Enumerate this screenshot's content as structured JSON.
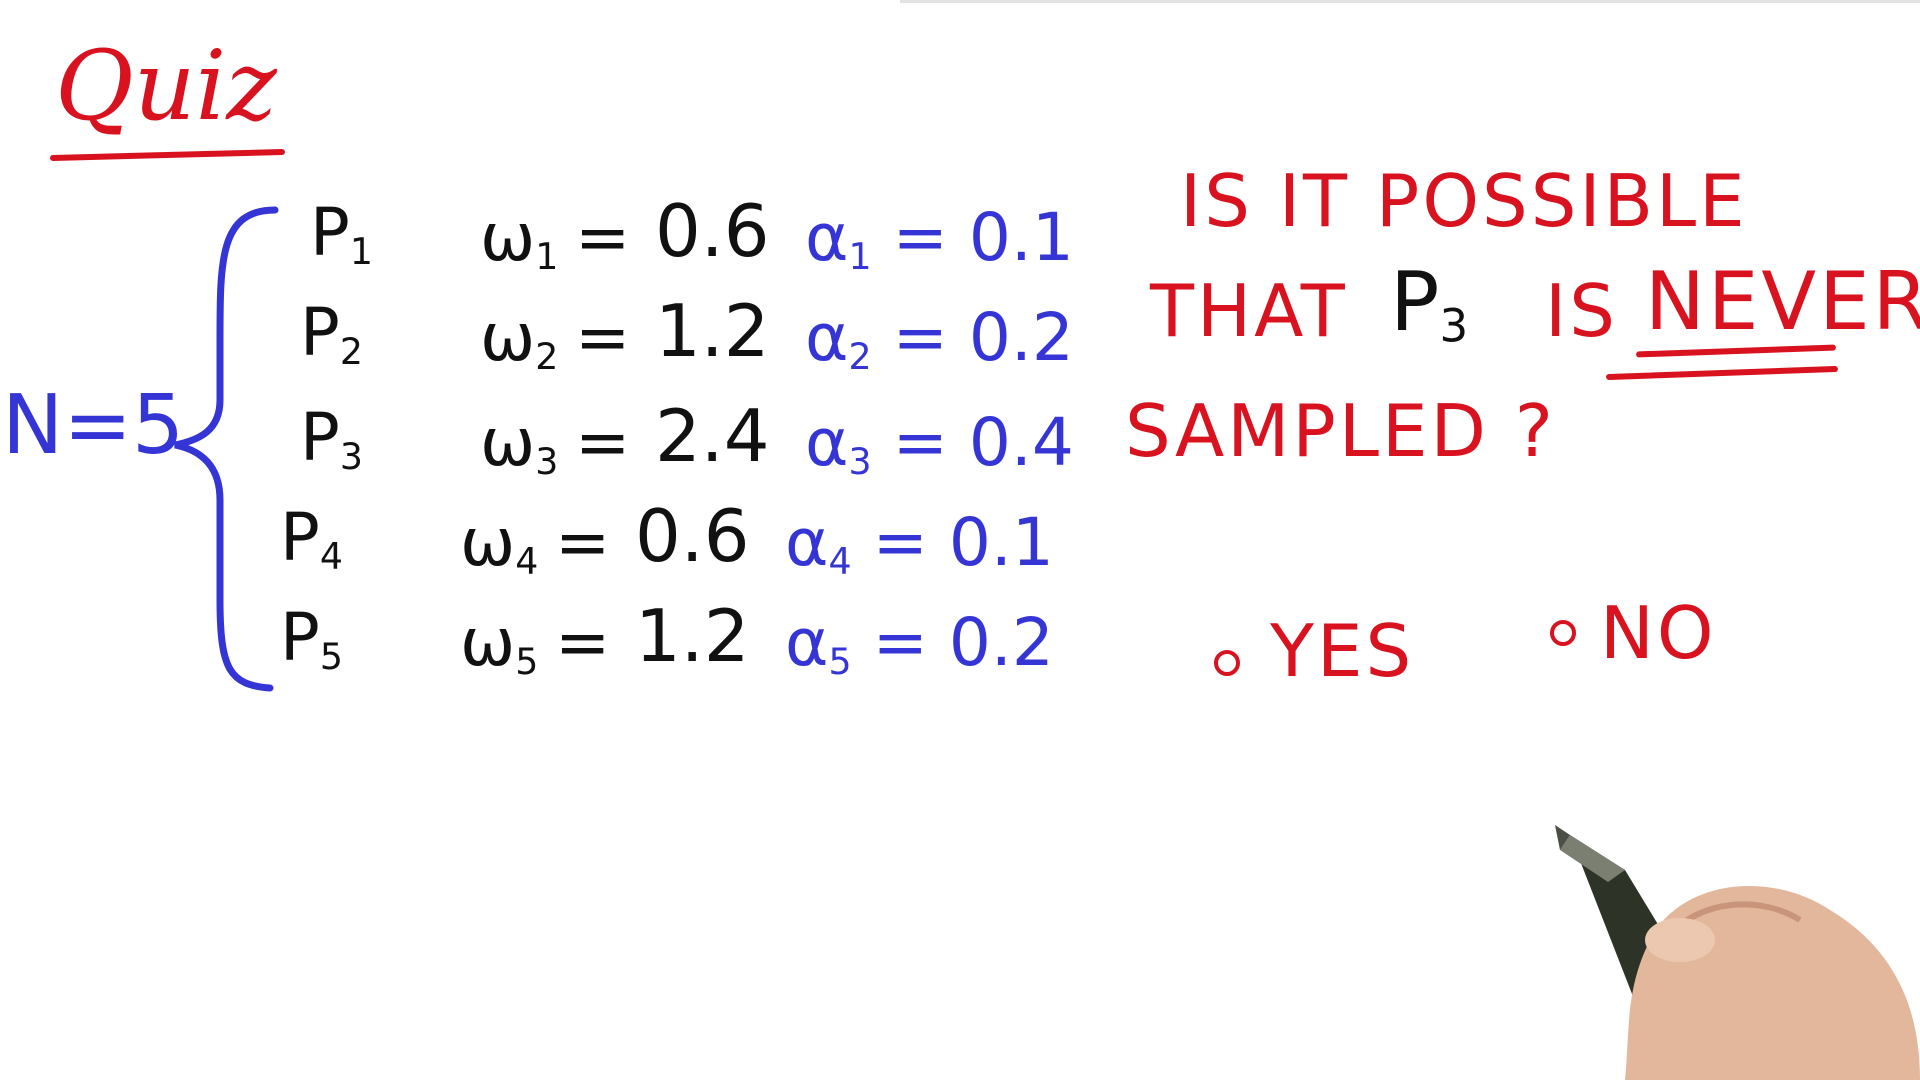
{
  "title": "Quiz",
  "n_label": "N=5",
  "particles": [
    {
      "p": "P",
      "p_sub": "1",
      "w": "ω",
      "w_sub": "1",
      "w_val": "0.6",
      "a": "α",
      "a_sub": "1",
      "a_val": "0.1"
    },
    {
      "p": "P",
      "p_sub": "2",
      "w": "ω",
      "w_sub": "2",
      "w_val": "1.2",
      "a": "α",
      "a_sub": "2",
      "a_val": "0.2"
    },
    {
      "p": "P",
      "p_sub": "3",
      "w": "ω",
      "w_sub": "3",
      "w_val": "2.4",
      "a": "α",
      "a_sub": "3",
      "a_val": "0.4"
    },
    {
      "p": "P",
      "p_sub": "4",
      "w": "ω",
      "w_sub": "4",
      "w_val": "0.6",
      "a": "α",
      "a_sub": "4",
      "a_val": "0.1"
    },
    {
      "p": "P",
      "p_sub": "5",
      "w": "ω",
      "w_sub": "5",
      "w_val": "1.2",
      "a": "α",
      "a_sub": "5",
      "a_val": "0.2"
    }
  ],
  "question": {
    "line1": "IS IT POSSIBLE",
    "line2_a": "THAT",
    "line2_p": "P",
    "line2_p_sub": "3",
    "line2_b": "IS",
    "line2_emph": "NEVER",
    "line3": "SAMPLED ?"
  },
  "options": {
    "yes": "YES",
    "no": "NO"
  },
  "colors": {
    "red": "#d8121e",
    "blue": "#3535d6",
    "black": "#111111"
  }
}
